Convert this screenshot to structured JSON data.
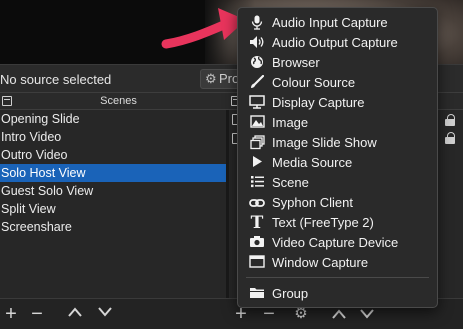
{
  "status": {
    "no_source": "No source selected",
    "properties_label": "Pro"
  },
  "scenes": {
    "title": "Scenes",
    "items": [
      {
        "label": "Opening Slide"
      },
      {
        "label": "Intro Video"
      },
      {
        "label": "Outro Video"
      },
      {
        "label": "Solo Host View",
        "selected": true
      },
      {
        "label": "Guest Solo View"
      },
      {
        "label": "Split View"
      },
      {
        "label": "Screenshare"
      }
    ]
  },
  "menu": {
    "items": [
      {
        "label": "Audio Input Capture",
        "icon": "microphone-icon"
      },
      {
        "label": "Audio Output Capture",
        "icon": "speaker-icon"
      },
      {
        "label": "Browser",
        "icon": "globe-icon"
      },
      {
        "label": "Colour Source",
        "icon": "paintbrush-icon"
      },
      {
        "label": "Display Capture",
        "icon": "monitor-icon"
      },
      {
        "label": "Image",
        "icon": "image-icon"
      },
      {
        "label": "Image Slide Show",
        "icon": "slideshow-icon"
      },
      {
        "label": "Media Source",
        "icon": "play-icon"
      },
      {
        "label": "Scene",
        "icon": "list-icon"
      },
      {
        "label": "Syphon Client",
        "icon": "link-icon"
      },
      {
        "label": "Text (FreeType 2)",
        "icon": "text-icon"
      },
      {
        "label": "Video Capture Device",
        "icon": "camera-icon"
      },
      {
        "label": "Window Capture",
        "icon": "window-icon"
      },
      {
        "label": "Group",
        "icon": "folder-icon"
      }
    ]
  },
  "colors": {
    "selection": "#1a63b8",
    "arrow": "#e8345c"
  }
}
